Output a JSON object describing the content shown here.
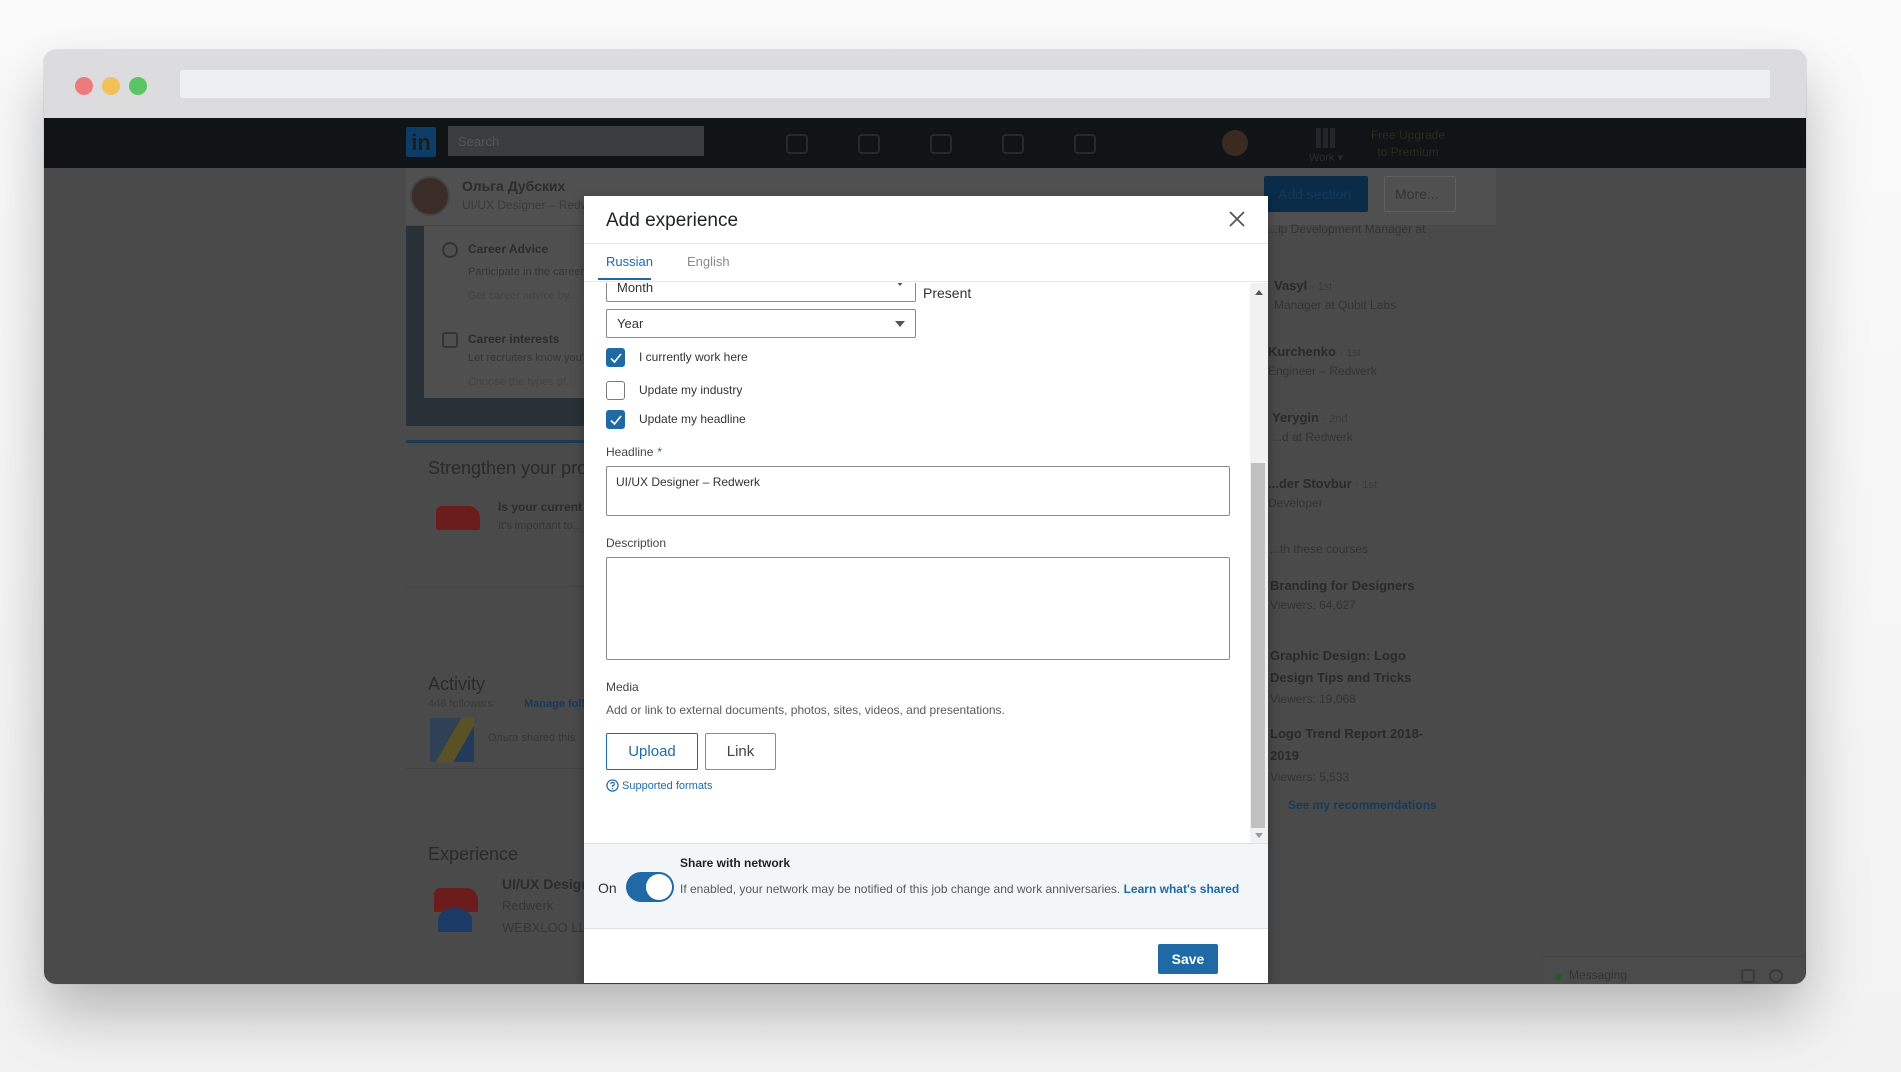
{
  "browser": {
    "controls": [
      "close",
      "minimize",
      "maximize"
    ],
    "url": ""
  },
  "background_page": {
    "nav": {
      "logo": "in",
      "search_placeholder": "Search",
      "icons": [
        "home-icon",
        "my-network-icon",
        "jobs-icon",
        "messaging-icon",
        "notifications-icon",
        "me-avatar"
      ],
      "work_label": "Work ▾",
      "premium_label_line1": "Free Upgrade",
      "premium_label_line2": "to Premium"
    },
    "profile": {
      "name": "Ольга Дубских",
      "headline": "UI/UX Designer – Redwerk",
      "action_button": "Add section",
      "more_button": "More..."
    },
    "dashboard": [
      {
        "title": "Career Advice",
        "line1": "Participate in the career advice platform",
        "line2": "Get career advice by..."
      },
      {
        "title": "Career interests",
        "line1": "Let recruiters know you're open",
        "line2": "Choose the types of..."
      }
    ],
    "strengthen": {
      "heading": "Strengthen your profile",
      "item_title": "Is your current position...",
      "item_text": "It's important to..."
    },
    "activity": {
      "heading": "Activity",
      "followers": "446 followers",
      "manage": "Manage followers",
      "post_text": "Ольга shared this"
    },
    "experience": {
      "heading": "Experience",
      "role": "UI/UX Designer",
      "company": "Redwerk",
      "next_company": "WEBXLOO LLC"
    },
    "right_rail": {
      "top_line": "...ip Development Manager at",
      "people": [
        {
          "name": "Vasyl",
          "degree": "· 1st",
          "title": "Manager at Qubit Labs"
        },
        {
          "name": "Kurchenko",
          "degree": "· 1st",
          "title": "Engineer – Redwerk"
        },
        {
          "name": "Yerygin",
          "degree": "· 2nd",
          "title": "...d at Redwerk"
        },
        {
          "name": "...der Stovbur",
          "degree": "· 1st",
          "title": "Developer"
        }
      ],
      "courses_heading": "...th these courses",
      "courses": [
        {
          "title_line1": "Branding for Designers",
          "title_line2": "",
          "viewers": "Viewers: 64,627"
        },
        {
          "title_line1": "Graphic Design: Logo",
          "title_line2": "Design Tips and Tricks",
          "viewers": "Viewers: 19,068"
        },
        {
          "title_line1": "Logo Trend Report 2018-",
          "title_line2": "2019",
          "viewers": "Viewers: 5,533"
        }
      ],
      "recommendations_link": "See my recommendations"
    },
    "messaging": {
      "label": "Messaging"
    }
  },
  "modal": {
    "title": "Add experience",
    "tabs": [
      {
        "label": "Russian",
        "active": true
      },
      {
        "label": "English",
        "active": false
      }
    ],
    "end_month_select": "Month",
    "present_label": "Present",
    "end_year_select": "Year",
    "checkboxes": [
      {
        "label": "I currently work here",
        "checked": true
      },
      {
        "label": "Update my industry",
        "checked": false
      },
      {
        "label": "Update my headline",
        "checked": true
      }
    ],
    "headline": {
      "label": "Headline",
      "required_mark": "*",
      "value": "UI/UX Designer – Redwerk"
    },
    "description": {
      "label": "Description",
      "value": ""
    },
    "media": {
      "label": "Media",
      "description": "Add or link to external documents, photos, sites, videos, and presentations.",
      "upload_button": "Upload",
      "link_button": "Link",
      "supported_formats": "Supported formats"
    },
    "share": {
      "toggle_state_label": "On",
      "toggle_on": true,
      "title": "Share with network",
      "description": "If enabled, your network may be notified of this job change and work anniversaries.",
      "learn_link": "Learn what's shared"
    },
    "save_button": "Save"
  },
  "colors": {
    "accent": "#1f6aa5",
    "overlay": "#4a4a4a",
    "nav_dark": "#111417"
  }
}
